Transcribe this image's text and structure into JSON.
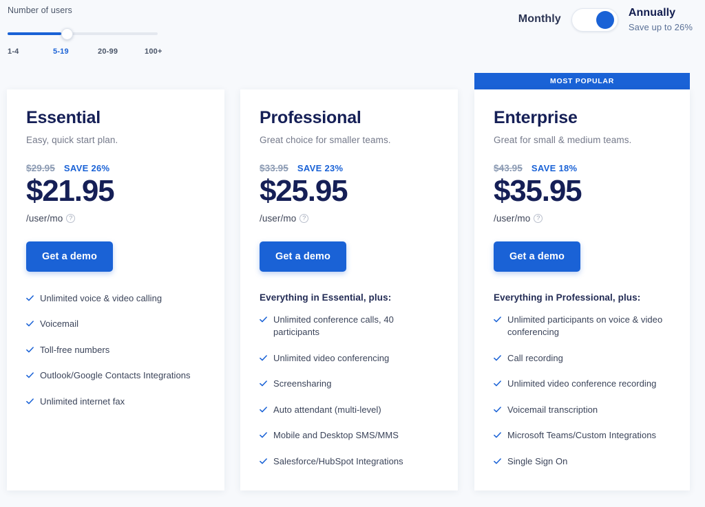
{
  "slider": {
    "label": "Number of users",
    "ticks": [
      "1-4",
      "5-19",
      "20-99",
      "100+"
    ],
    "active_tick": "5-19",
    "active_index": 1,
    "fill_color": "#1a62d6",
    "track_color": "#e4e8ef"
  },
  "billing": {
    "monthly_label": "Monthly",
    "annually_label": "Annually",
    "save_note": "Save up to 26%",
    "selected": "Annually",
    "knob_color": "#1a62d6"
  },
  "badge": {
    "text": "MOST POPULAR",
    "color": "#1a62d6"
  },
  "permo_label": "/user/mo",
  "info_icon_glyph": "?",
  "plans": [
    {
      "name": "Essential",
      "description": "Easy, quick start plan.",
      "old_price": "$29.95",
      "save": "SAVE 26%",
      "price": "$21.95",
      "cta": "Get a demo",
      "features_heading": "",
      "features": [
        "Unlimited voice & video calling",
        "Voicemail",
        "Toll-free numbers",
        "Outlook/Google Contacts Integrations",
        "Unlimited internet fax"
      ]
    },
    {
      "name": "Professional",
      "description": "Great choice for smaller teams.",
      "old_price": "$33.95",
      "save": "SAVE 23%",
      "price": "$25.95",
      "cta": "Get a demo",
      "features_heading": "Everything in Essential, plus:",
      "features": [
        "Unlimited conference calls, 40 participants",
        "Unlimited video conferencing",
        "Screensharing",
        "Auto attendant (multi-level)",
        "Mobile and Desktop SMS/MMS",
        "Salesforce/HubSpot Integrations"
      ]
    },
    {
      "name": "Enterprise",
      "description": "Great for small & medium teams.",
      "old_price": "$43.95",
      "save": "SAVE 18%",
      "price": "$35.95",
      "cta": "Get a demo",
      "features_heading": "Everything in Professional, plus:",
      "features": [
        "Unlimited participants on voice & video conferencing",
        "Call recording",
        "Unlimited video conference recording",
        "Voicemail transcription",
        "Microsoft Teams/Custom Integrations",
        "Single Sign On"
      ]
    }
  ]
}
